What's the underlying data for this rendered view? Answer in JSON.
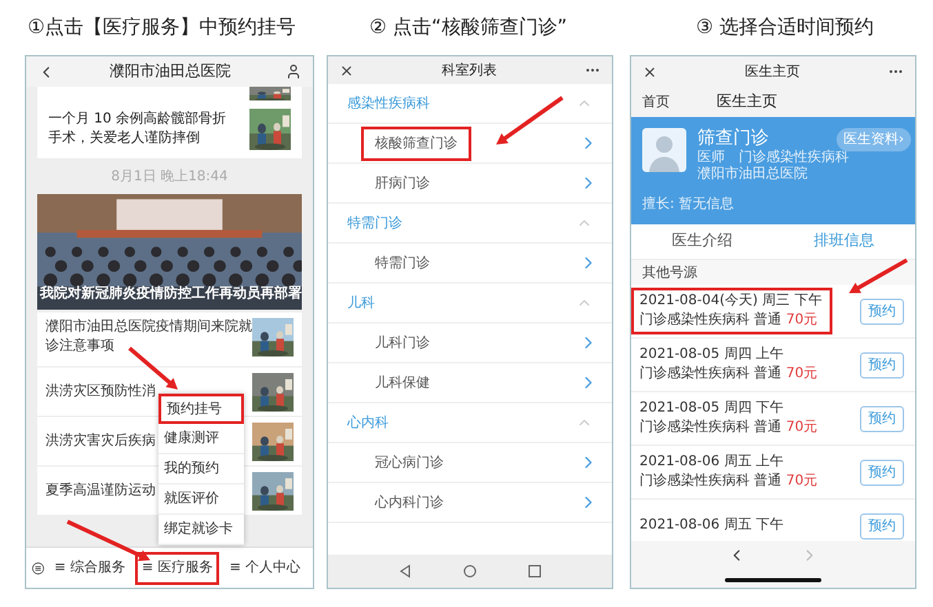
{
  "captions": [
    "①点击【医疗服务】中预约挂号",
    "② 点击“核酸筛查门诊”",
    "③ 选择合适时间预约"
  ],
  "news_app": {
    "title": "濮阳市油田总医院",
    "article": "一个月 10 余例高龄髋部骨折手术，关爱老人谨防摔倒",
    "date": "8月1日 晚上18:44",
    "feature_caption": "我院对新冠肺炎疫情防控工作再动员再部署",
    "list": [
      "濮阳市油田总医院疫情期间来院就诊注意事项",
      "洪涝灾区预防性消",
      "洪涝灾害灾后疾病",
      "夏季高温谨防运动"
    ],
    "menu": [
      {
        "label": "预约挂号",
        "highlighted": true
      },
      {
        "label": "健康测评",
        "highlighted": false
      },
      {
        "label": "我的预约",
        "highlighted": false
      },
      {
        "label": "就医评价",
        "highlighted": false
      },
      {
        "label": "绑定就诊卡",
        "highlighted": false
      }
    ],
    "tabbar": [
      {
        "label": "≡ 综合服务",
        "highlighted": false
      },
      {
        "label": "≡ 医疗服务",
        "highlighted": true
      },
      {
        "label": "≡ 个人中心",
        "highlighted": false
      }
    ]
  },
  "department_list": {
    "title": "科室列表",
    "sections": [
      {
        "title": "感染性疾病科",
        "expanded": true,
        "items": [
          {
            "label": "核酸筛查门诊",
            "highlighted": true
          },
          {
            "label": "肝病门诊",
            "highlighted": false
          }
        ]
      },
      {
        "title": "特需门诊",
        "expanded": true,
        "items": [
          {
            "label": "特需门诊",
            "highlighted": false
          }
        ]
      },
      {
        "title": "儿科",
        "expanded": true,
        "items": [
          {
            "label": "儿科门诊",
            "highlighted": false
          },
          {
            "label": "儿科保健",
            "highlighted": false
          }
        ]
      },
      {
        "title": "心内科",
        "expanded": true,
        "items": [
          {
            "label": "冠心病门诊",
            "highlighted": false
          },
          {
            "label": "心内科门诊",
            "highlighted": false
          }
        ]
      }
    ]
  },
  "doctor_page": {
    "title": "医生主页",
    "home": "首页",
    "subtitle": "医生主页",
    "name": "筛查门诊",
    "role": "医师　门诊感染性疾病科",
    "hospital": "濮阳市油田总医院",
    "profile_button": "医生资料›",
    "specialty": "擅长: 暂无信息",
    "tabs": [
      {
        "label": "医生介绍",
        "selected": false
      },
      {
        "label": "排班信息",
        "selected": true
      }
    ],
    "section": "其他号源",
    "slots": [
      {
        "date": "2021-08-04(今天) 周三 下午",
        "department": "门诊感染性疾病科 普通",
        "price": "70元",
        "button": "预约",
        "highlighted": true
      },
      {
        "date": "2021-08-05 周四 上午",
        "department": "门诊感染性疾病科 普通",
        "price": "70元",
        "button": "预约",
        "highlighted": false
      },
      {
        "date": "2021-08-05 周四 下午",
        "department": "门诊感染性疾病科 普通",
        "price": "70元",
        "button": "预约",
        "highlighted": false
      },
      {
        "date": "2021-08-06 周五 上午",
        "department": "门诊感染性疾病科 普通",
        "price": "70元",
        "button": "预约",
        "highlighted": false
      },
      {
        "date": "2021-08-06 周五 下午",
        "button": "预约",
        "highlighted": false
      }
    ]
  }
}
